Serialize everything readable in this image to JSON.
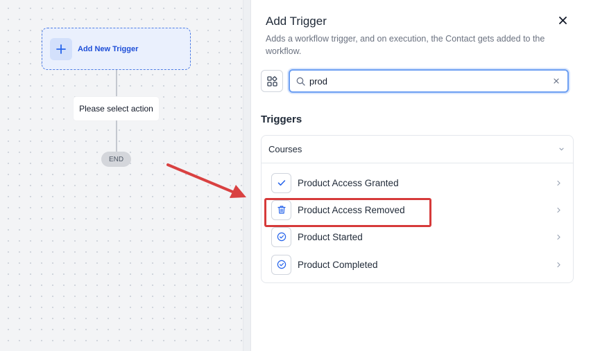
{
  "canvas": {
    "trigger_label": "Add New Trigger",
    "action_label": "Please select action",
    "end_label": "END"
  },
  "panel": {
    "title": "Add Trigger",
    "description": "Adds a workflow trigger, and on execution, the Contact gets added to the workflow.",
    "search": {
      "value": "prod",
      "placeholder": ""
    },
    "section_title": "Triggers",
    "group": {
      "label": "Courses",
      "items": [
        {
          "label": "Product Access Granted",
          "icon": "check-icon"
        },
        {
          "label": "Product Access Removed",
          "icon": "trash-icon"
        },
        {
          "label": "Product Started",
          "icon": "check-circle-icon"
        },
        {
          "label": "Product Completed",
          "icon": "check-circle-icon"
        }
      ]
    }
  },
  "colors": {
    "accent": "#2563eb",
    "highlight": "#d63a3a",
    "annotation_arrow": "#d94141"
  }
}
